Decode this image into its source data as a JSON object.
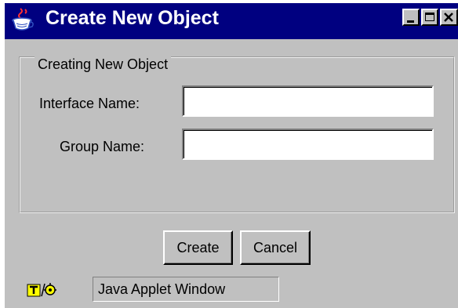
{
  "window": {
    "title": "Create New Object",
    "controls": {
      "minimize": "minimize-icon",
      "maximize": "maximize-icon",
      "close": "close-icon"
    }
  },
  "form": {
    "group_title": "Creating New Object",
    "interface_label": "Interface Name:",
    "interface_value": "",
    "group_label": "Group Name:",
    "group_value": ""
  },
  "buttons": {
    "create": "Create",
    "cancel": "Cancel"
  },
  "status": {
    "text": "Java Applet Window"
  },
  "colors": {
    "titlebar": "#000080",
    "face": "#c0c0c0"
  }
}
